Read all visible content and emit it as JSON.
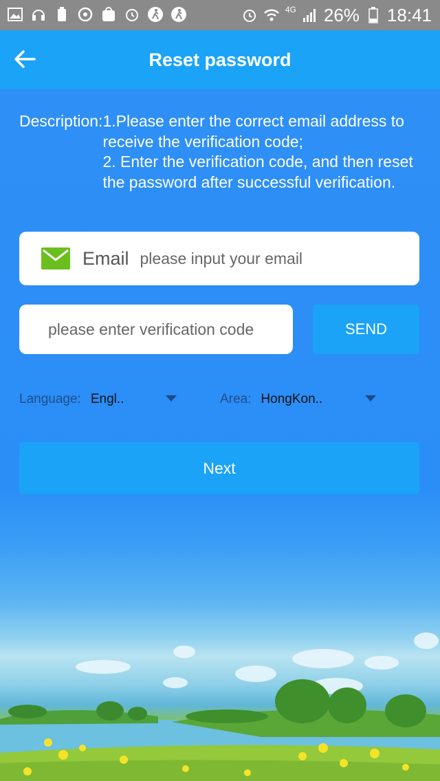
{
  "status_bar": {
    "battery": "26%",
    "time": "18:41",
    "network": "4G"
  },
  "header": {
    "title": "Reset password"
  },
  "description": {
    "label": "Description:",
    "lines": "1.Please enter the correct email address to receive the verification code;\n2. Enter the verification code, and then reset the password after successful verification."
  },
  "email": {
    "label": "Email",
    "placeholder": "please input your email",
    "value": ""
  },
  "verification": {
    "placeholder": "please enter verification code",
    "value": "",
    "send_label": "SEND"
  },
  "language": {
    "label": "Language:",
    "value": "Engl.."
  },
  "area": {
    "label": "Area:",
    "value": "HongKon.."
  },
  "next_label": "Next",
  "colors": {
    "primary": "#1aa3f7",
    "background": "#2f8cf5",
    "email_icon": "#6abf1e"
  }
}
